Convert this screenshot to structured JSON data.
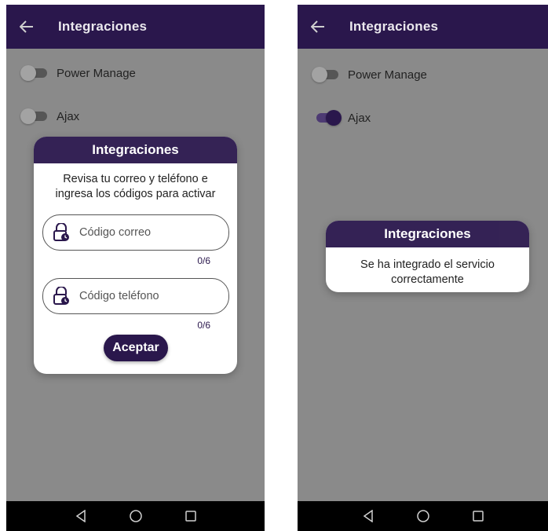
{
  "left": {
    "appbar_title": "Integraciones",
    "items": [
      {
        "label": "Power Manage",
        "enabled": false
      },
      {
        "label": "Ajax",
        "enabled": false
      }
    ],
    "dialog": {
      "title": "Integraciones",
      "message_line1": "Revisa tu correo y teléfono e",
      "message_line2": "ingresa los códigos para activar",
      "email_placeholder": "Código correo",
      "email_counter": "0/6",
      "phone_placeholder": "Código teléfono",
      "phone_counter": "0/6",
      "accept_label": "Aceptar"
    }
  },
  "right": {
    "appbar_title": "Integraciones",
    "items": [
      {
        "label": "Power Manage",
        "enabled": false
      },
      {
        "label": "Ajax",
        "enabled": true
      }
    ],
    "dialog": {
      "title": "Integraciones",
      "message_line1": "Se ha integrado el servicio",
      "message_line2": "correctamente"
    }
  },
  "colors": {
    "primary": "#2a174c",
    "scrim": "#8a8a8a",
    "navbar": "#000000"
  },
  "icons": {
    "back": "arrow-left-icon",
    "field": "lock-clock-icon",
    "nav": [
      "back-triangle-icon",
      "home-circle-icon",
      "recents-square-icon"
    ]
  }
}
